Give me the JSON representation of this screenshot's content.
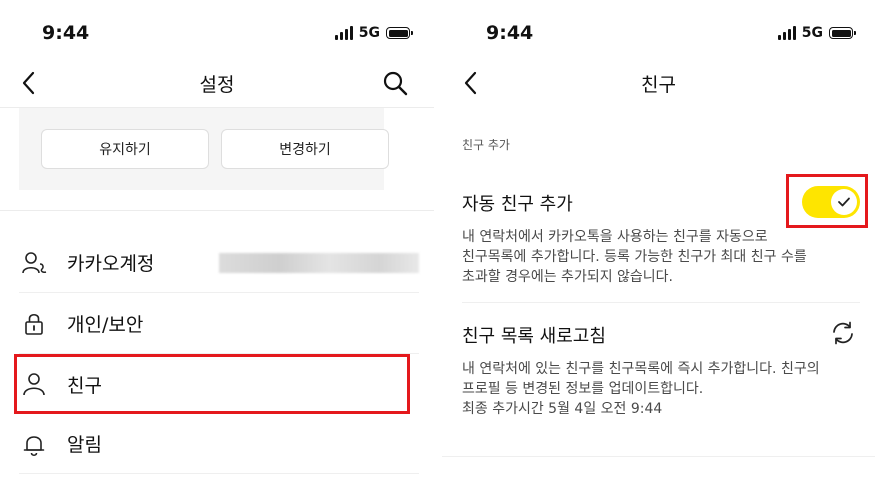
{
  "left": {
    "status": {
      "time": "9:44",
      "network": "5G"
    },
    "nav": {
      "title": "설정"
    },
    "panel": {
      "keep_label": "유지하기",
      "change_label": "변경하기"
    },
    "menu": [
      {
        "label": "카카오계정",
        "icon": "account-icon"
      },
      {
        "label": "개인/보안",
        "icon": "lock-icon"
      },
      {
        "label": "친구",
        "icon": "person-icon"
      },
      {
        "label": "알림",
        "icon": "bell-icon"
      }
    ]
  },
  "right": {
    "status": {
      "time": "9:44",
      "network": "5G"
    },
    "nav": {
      "title": "친구"
    },
    "section_header": "친구 추가",
    "auto_add": {
      "title": "자동 친구 추가",
      "desc_lines": [
        "내 연락처에서 카카오톡을 사용하는 친구를 자동으로",
        "친구목록에 추가합니다. 등록 가능한 친구가 최대 친구 수를",
        "초과할 경우에는 추가되지 않습니다."
      ],
      "enabled": true
    },
    "refresh": {
      "title": "친구 목록 새로고침",
      "desc_lines": [
        "내 연락처에 있는 친구를 친구목록에 즉시 추가합니다. 친구의",
        "프로필 등 변경된 정보를 업데이트합니다.",
        "최종 추가시간 5월 4일 오전 9:44"
      ]
    }
  },
  "colors": {
    "accent_yellow": "#fee500",
    "highlight_red": "#e4181c"
  }
}
